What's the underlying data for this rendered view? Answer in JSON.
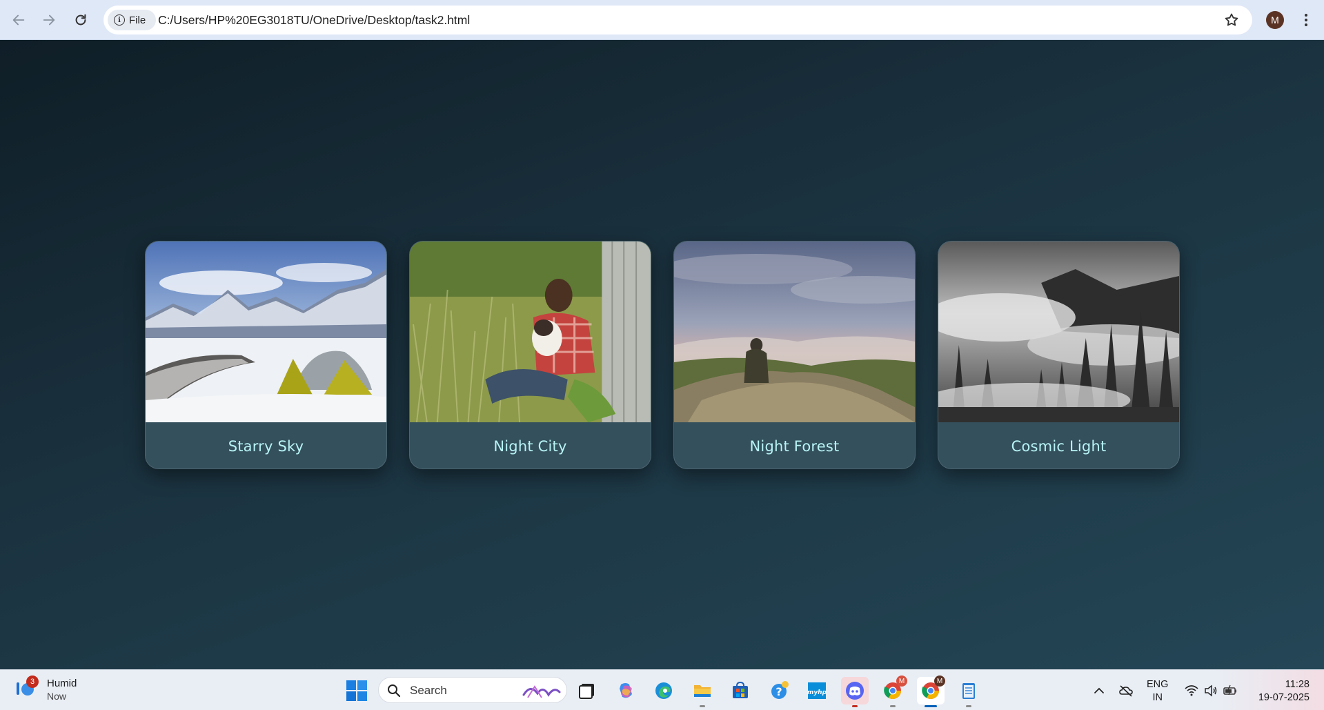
{
  "browser": {
    "site_chip_label": "File",
    "url": "C:/Users/HP%20EG3018TU/OneDrive/Desktop/task2.html",
    "profile_initial": "M"
  },
  "cards": [
    {
      "title": "Starry Sky",
      "image": "snowy-mountain-camp"
    },
    {
      "title": "Night City",
      "image": "man-with-dog-in-grass"
    },
    {
      "title": "Night Forest",
      "image": "hiker-on-misty-cliff"
    },
    {
      "title": "Cosmic Light",
      "image": "foggy-forest-monochrome"
    }
  ],
  "colors": {
    "card_title": "#b7f3f6",
    "card_footer": "#34505d",
    "page_bg_dark": "#0f1e27",
    "page_bg_light": "#244656"
  },
  "taskbar": {
    "weather_badge": "3",
    "weather_condition": "Humid",
    "weather_time": "Now",
    "search_placeholder": "Search",
    "language_line1": "ENG",
    "language_line2": "IN",
    "time": "11:28",
    "date": "19-07-2025",
    "apps": [
      "start",
      "search",
      "task-view",
      "copilot",
      "edge",
      "file-explorer",
      "microsoft-store",
      "get-help",
      "myhp",
      "discord",
      "chrome",
      "chrome",
      "notepad"
    ]
  }
}
